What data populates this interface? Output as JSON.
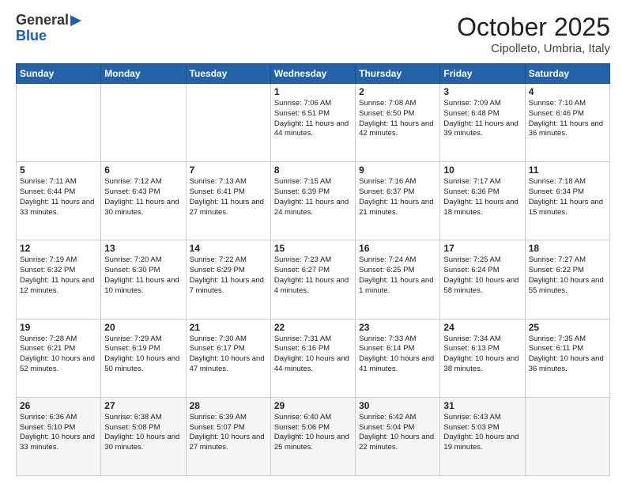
{
  "logo": {
    "line1": "General",
    "line2": "Blue"
  },
  "title": "October 2025",
  "subtitle": "Cipolleto, Umbria, Italy",
  "days_of_week": [
    "Sunday",
    "Monday",
    "Tuesday",
    "Wednesday",
    "Thursday",
    "Friday",
    "Saturday"
  ],
  "weeks": [
    [
      {
        "day": "",
        "sunrise": "",
        "sunset": "",
        "daylight": ""
      },
      {
        "day": "",
        "sunrise": "",
        "sunset": "",
        "daylight": ""
      },
      {
        "day": "",
        "sunrise": "",
        "sunset": "",
        "daylight": ""
      },
      {
        "day": "1",
        "sunrise": "Sunrise: 7:06 AM",
        "sunset": "Sunset: 6:51 PM",
        "daylight": "Daylight: 11 hours and 44 minutes."
      },
      {
        "day": "2",
        "sunrise": "Sunrise: 7:08 AM",
        "sunset": "Sunset: 6:50 PM",
        "daylight": "Daylight: 11 hours and 42 minutes."
      },
      {
        "day": "3",
        "sunrise": "Sunrise: 7:09 AM",
        "sunset": "Sunset: 6:48 PM",
        "daylight": "Daylight: 11 hours and 39 minutes."
      },
      {
        "day": "4",
        "sunrise": "Sunrise: 7:10 AM",
        "sunset": "Sunset: 6:46 PM",
        "daylight": "Daylight: 11 hours and 36 minutes."
      }
    ],
    [
      {
        "day": "5",
        "sunrise": "Sunrise: 7:11 AM",
        "sunset": "Sunset: 6:44 PM",
        "daylight": "Daylight: 11 hours and 33 minutes."
      },
      {
        "day": "6",
        "sunrise": "Sunrise: 7:12 AM",
        "sunset": "Sunset: 6:43 PM",
        "daylight": "Daylight: 11 hours and 30 minutes."
      },
      {
        "day": "7",
        "sunrise": "Sunrise: 7:13 AM",
        "sunset": "Sunset: 6:41 PM",
        "daylight": "Daylight: 11 hours and 27 minutes."
      },
      {
        "day": "8",
        "sunrise": "Sunrise: 7:15 AM",
        "sunset": "Sunset: 6:39 PM",
        "daylight": "Daylight: 11 hours and 24 minutes."
      },
      {
        "day": "9",
        "sunrise": "Sunrise: 7:16 AM",
        "sunset": "Sunset: 6:37 PM",
        "daylight": "Daylight: 11 hours and 21 minutes."
      },
      {
        "day": "10",
        "sunrise": "Sunrise: 7:17 AM",
        "sunset": "Sunset: 6:36 PM",
        "daylight": "Daylight: 11 hours and 18 minutes."
      },
      {
        "day": "11",
        "sunrise": "Sunrise: 7:18 AM",
        "sunset": "Sunset: 6:34 PM",
        "daylight": "Daylight: 11 hours and 15 minutes."
      }
    ],
    [
      {
        "day": "12",
        "sunrise": "Sunrise: 7:19 AM",
        "sunset": "Sunset: 6:32 PM",
        "daylight": "Daylight: 11 hours and 12 minutes."
      },
      {
        "day": "13",
        "sunrise": "Sunrise: 7:20 AM",
        "sunset": "Sunset: 6:30 PM",
        "daylight": "Daylight: 11 hours and 10 minutes."
      },
      {
        "day": "14",
        "sunrise": "Sunrise: 7:22 AM",
        "sunset": "Sunset: 6:29 PM",
        "daylight": "Daylight: 11 hours and 7 minutes."
      },
      {
        "day": "15",
        "sunrise": "Sunrise: 7:23 AM",
        "sunset": "Sunset: 6:27 PM",
        "daylight": "Daylight: 11 hours and 4 minutes."
      },
      {
        "day": "16",
        "sunrise": "Sunrise: 7:24 AM",
        "sunset": "Sunset: 6:25 PM",
        "daylight": "Daylight: 11 hours and 1 minute."
      },
      {
        "day": "17",
        "sunrise": "Sunrise: 7:25 AM",
        "sunset": "Sunset: 6:24 PM",
        "daylight": "Daylight: 10 hours and 58 minutes."
      },
      {
        "day": "18",
        "sunrise": "Sunrise: 7:27 AM",
        "sunset": "Sunset: 6:22 PM",
        "daylight": "Daylight: 10 hours and 55 minutes."
      }
    ],
    [
      {
        "day": "19",
        "sunrise": "Sunrise: 7:28 AM",
        "sunset": "Sunset: 6:21 PM",
        "daylight": "Daylight: 10 hours and 52 minutes."
      },
      {
        "day": "20",
        "sunrise": "Sunrise: 7:29 AM",
        "sunset": "Sunset: 6:19 PM",
        "daylight": "Daylight: 10 hours and 50 minutes."
      },
      {
        "day": "21",
        "sunrise": "Sunrise: 7:30 AM",
        "sunset": "Sunset: 6:17 PM",
        "daylight": "Daylight: 10 hours and 47 minutes."
      },
      {
        "day": "22",
        "sunrise": "Sunrise: 7:31 AM",
        "sunset": "Sunset: 6:16 PM",
        "daylight": "Daylight: 10 hours and 44 minutes."
      },
      {
        "day": "23",
        "sunrise": "Sunrise: 7:33 AM",
        "sunset": "Sunset: 6:14 PM",
        "daylight": "Daylight: 10 hours and 41 minutes."
      },
      {
        "day": "24",
        "sunrise": "Sunrise: 7:34 AM",
        "sunset": "Sunset: 6:13 PM",
        "daylight": "Daylight: 10 hours and 38 minutes."
      },
      {
        "day": "25",
        "sunrise": "Sunrise: 7:35 AM",
        "sunset": "Sunset: 6:11 PM",
        "daylight": "Daylight: 10 hours and 36 minutes."
      }
    ],
    [
      {
        "day": "26",
        "sunrise": "Sunrise: 6:36 AM",
        "sunset": "Sunset: 5:10 PM",
        "daylight": "Daylight: 10 hours and 33 minutes."
      },
      {
        "day": "27",
        "sunrise": "Sunrise: 6:38 AM",
        "sunset": "Sunset: 5:08 PM",
        "daylight": "Daylight: 10 hours and 30 minutes."
      },
      {
        "day": "28",
        "sunrise": "Sunrise: 6:39 AM",
        "sunset": "Sunset: 5:07 PM",
        "daylight": "Daylight: 10 hours and 27 minutes."
      },
      {
        "day": "29",
        "sunrise": "Sunrise: 6:40 AM",
        "sunset": "Sunset: 5:06 PM",
        "daylight": "Daylight: 10 hours and 25 minutes."
      },
      {
        "day": "30",
        "sunrise": "Sunrise: 6:42 AM",
        "sunset": "Sunset: 5:04 PM",
        "daylight": "Daylight: 10 hours and 22 minutes."
      },
      {
        "day": "31",
        "sunrise": "Sunrise: 6:43 AM",
        "sunset": "Sunset: 5:03 PM",
        "daylight": "Daylight: 10 hours and 19 minutes."
      },
      {
        "day": "",
        "sunrise": "",
        "sunset": "",
        "daylight": ""
      }
    ]
  ]
}
